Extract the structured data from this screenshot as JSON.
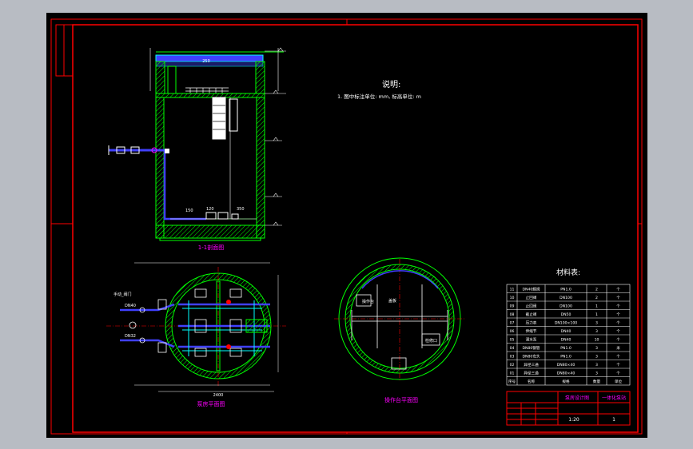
{
  "drawing": {
    "section_title": "1-1剖面图",
    "plan_title": "泵房平面图",
    "top_plan_title": "操作台平面图",
    "notes": {
      "heading": "说明:",
      "line1": "1. 图中标注单位: mm, 标高单位: m"
    },
    "section_labels": {
      "top_dim": "250",
      "dim_a": "150",
      "dim_b": "120",
      "dim_c": "350"
    },
    "plan_labels": {
      "valve_label": "手动_阀门",
      "dia_a": "DN40",
      "dia_b": "DN32",
      "width": "2400"
    },
    "top_plan_labels": {
      "left_box": "操作台",
      "right_box": "检修口",
      "grid_label": "盖板"
    }
  },
  "materials": {
    "heading": "材料表:",
    "rows": [
      {
        "no": "11",
        "name": "DN40蝶阀",
        "spec": "PN1.0",
        "qty": "2",
        "unit": "个"
      },
      {
        "no": "10",
        "name": "止回阀",
        "spec": "DN100",
        "qty": "2",
        "unit": "个"
      },
      {
        "no": "09",
        "name": "止回阀",
        "spec": "DN100",
        "qty": "1",
        "unit": "个"
      },
      {
        "no": "08",
        "name": "截止阀",
        "spec": "DN50",
        "qty": "1",
        "unit": "个"
      },
      {
        "no": "07",
        "name": "压力表",
        "spec": "DN100×100",
        "qty": "3",
        "unit": "个"
      },
      {
        "no": "06",
        "name": "伸缩节",
        "spec": "DN40",
        "qty": "3",
        "unit": "个"
      },
      {
        "no": "05",
        "name": "潜水泵",
        "spec": "DN40",
        "qty": "10",
        "unit": "个"
      },
      {
        "no": "04",
        "name": "DN80钢管",
        "spec": "PN1.0",
        "qty": "3",
        "unit": "米"
      },
      {
        "no": "03",
        "name": "DN80弯头",
        "spec": "PN1.0",
        "qty": "3",
        "unit": "个"
      },
      {
        "no": "02",
        "name": "异径三通",
        "spec": "DN80×40",
        "qty": "3",
        "unit": "个"
      },
      {
        "no": "01",
        "name": "异径三通",
        "spec": "DN80×40",
        "qty": "3",
        "unit": "个"
      }
    ],
    "header": {
      "no": "序号",
      "name": "名称",
      "spec": "规格",
      "qty": "数量",
      "unit": "单位"
    }
  },
  "title_block": {
    "project": "泵房设计图",
    "drawing_name": "一体化泵站",
    "scale": "1:20",
    "sheet": "1"
  },
  "colors": {
    "frame": "#ff0000",
    "wall": "#00ff00",
    "pipe": "#4040ff",
    "center": "#ff0000",
    "text": "#ffffff",
    "magenta": "#ff00ff",
    "cyan": "#00ffff",
    "yellow": "#ffff00"
  }
}
